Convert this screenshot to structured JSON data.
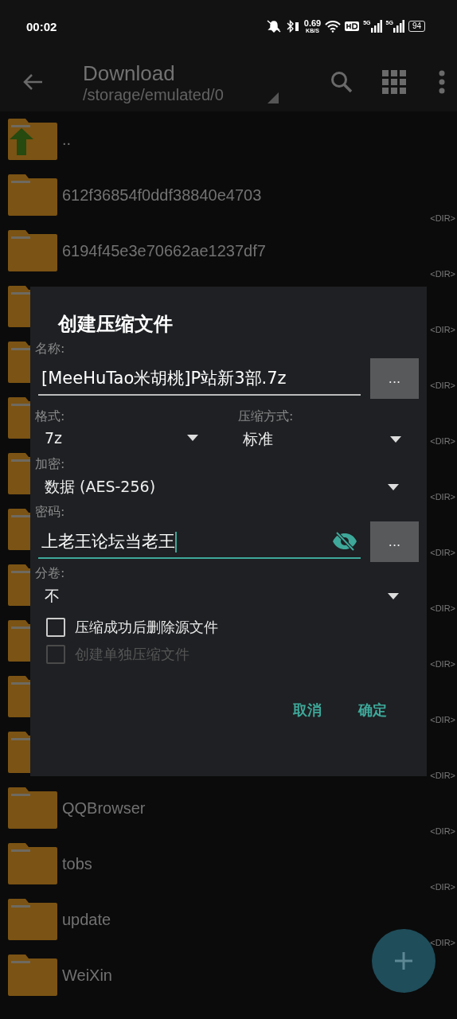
{
  "status_bar": {
    "time": "00:02",
    "net_speed": "0.69",
    "net_unit": "KB/S",
    "signals": [
      "5G",
      "5G"
    ],
    "battery": "94"
  },
  "toolbar": {
    "title": "Download",
    "path": "/storage/emulated/0"
  },
  "files": [
    {
      "kind": "up",
      "name": ".."
    },
    {
      "kind": "folder",
      "name": "612f36854f0ddf38840e4703",
      "tag": "<DIR>"
    },
    {
      "kind": "folder",
      "name": "6194f45e3e70662ae1237df7",
      "tag": "<DIR>"
    },
    {
      "kind": "folder",
      "tag": "<DIR>"
    },
    {
      "kind": "folder",
      "tag": "<DIR>"
    },
    {
      "kind": "folder",
      "tag": "<DIR>"
    },
    {
      "kind": "folder",
      "tag": "<DIR>"
    },
    {
      "kind": "folder",
      "tag": "<DIR>"
    },
    {
      "kind": "folder",
      "tag": "<DIR>"
    },
    {
      "kind": "folder",
      "tag": "<DIR>"
    },
    {
      "kind": "folder",
      "tag": "<DIR>"
    },
    {
      "kind": "folder",
      "tag": "<DIR>"
    },
    {
      "kind": "folder",
      "name": "QQBrowser",
      "tag": "<DIR>"
    },
    {
      "kind": "folder",
      "name": "tobs",
      "tag": "<DIR>"
    },
    {
      "kind": "folder",
      "name": "update",
      "tag": "<DIR>"
    },
    {
      "kind": "folder",
      "name": "WeiXin"
    }
  ],
  "dialog": {
    "title": "创建压缩文件",
    "name_label": "名称:",
    "name_value": "[MeeHuTao米胡桃]P站新3部.7z",
    "browse_button": "...",
    "format_label": "格式:",
    "format_value": "7z",
    "method_label": "压缩方式:",
    "method_value": "标准",
    "encryption_label": "加密:",
    "encryption_value": "数据 (AES-256)",
    "password_label": "密码:",
    "password_value": "上老王论坛当老王",
    "password_focused": true,
    "password_browse_button": "...",
    "volume_label": "分卷:",
    "volume_value": "不",
    "checkboxes": [
      {
        "label": "压缩成功后删除源文件",
        "checked": false,
        "disabled": false
      },
      {
        "label": "创建单独压缩文件",
        "checked": false,
        "disabled": true
      }
    ],
    "buttons": [
      "取消",
      "确定"
    ]
  }
}
